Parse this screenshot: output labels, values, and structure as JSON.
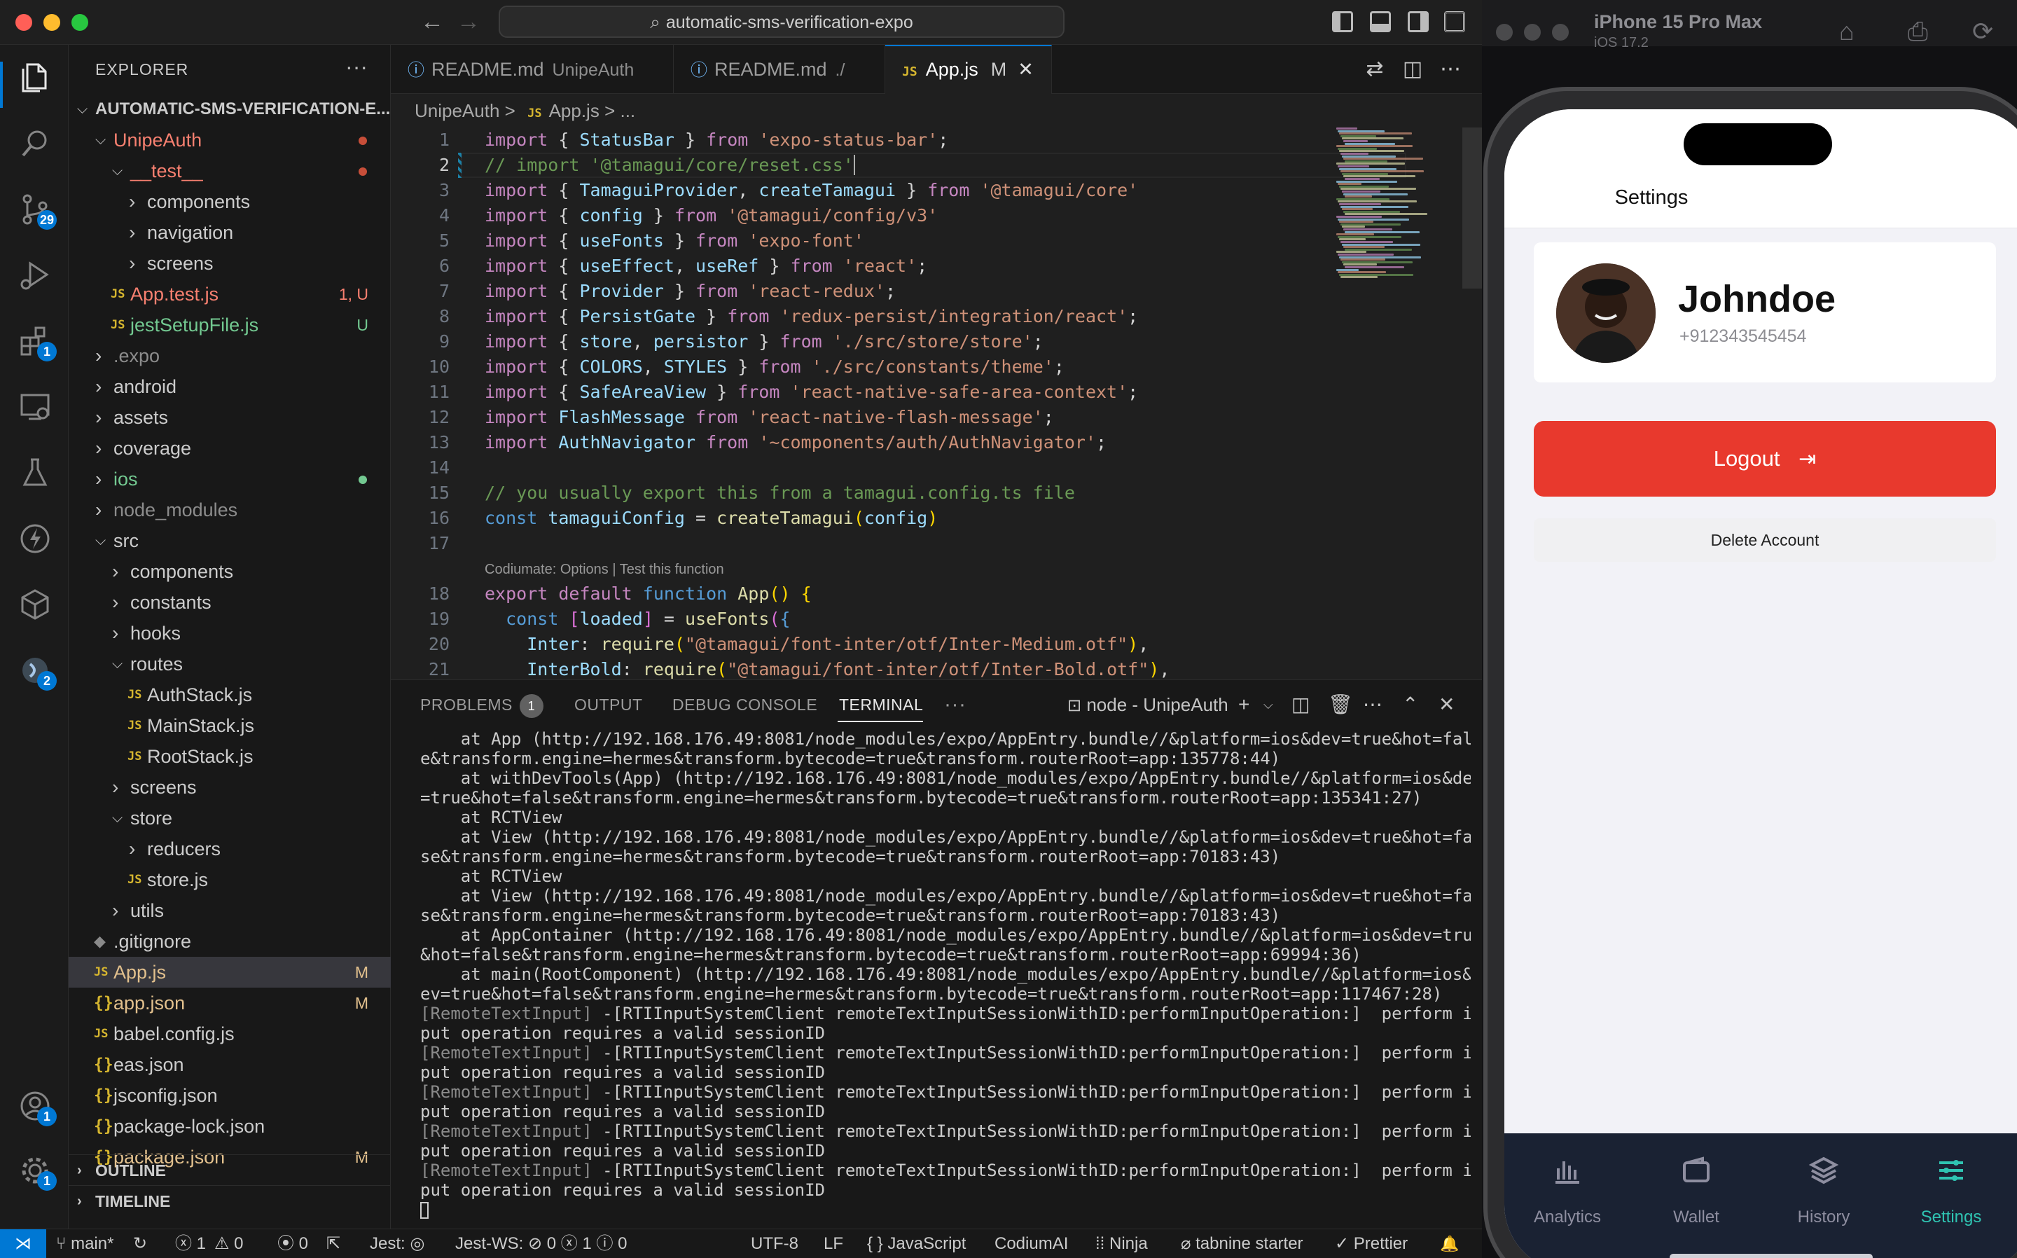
{
  "window": {
    "search_text": "automatic-sms-verification-expo",
    "back_arrow": "←",
    "forward_arrow": "→"
  },
  "activity_bar": {
    "source_control_badge": "29",
    "extensions_badge": "1",
    "codium_badge": "2",
    "accounts_badge": "1",
    "settings_badge": "1"
  },
  "explorer": {
    "title": "EXPLORER",
    "more": "···",
    "project": "AUTOMATIC-SMS-VERIFICATION-E...",
    "tree": [
      {
        "label": "UnipeAuth",
        "type": "folder",
        "open": true,
        "depth": 0,
        "color": "#f88070",
        "dot": "#c74e39"
      },
      {
        "label": "__test__",
        "type": "folder",
        "open": true,
        "depth": 1,
        "color": "#f88070",
        "dot": "#c74e39"
      },
      {
        "label": "components",
        "type": "folder",
        "open": false,
        "depth": 2
      },
      {
        "label": "navigation",
        "type": "folder",
        "open": false,
        "depth": 2
      },
      {
        "label": "screens",
        "type": "folder",
        "open": false,
        "depth": 2
      },
      {
        "label": "App.test.js",
        "type": "js",
        "depth": 1,
        "color": "#f88070",
        "status": "1, U",
        "status_color": "#f88070"
      },
      {
        "label": "jestSetupFile.js",
        "type": "js",
        "depth": 1,
        "color": "#73c991",
        "status": "U",
        "status_color": "#73c991"
      },
      {
        "label": ".expo",
        "type": "folder",
        "open": false,
        "depth": 0,
        "color": "#8c8c8c"
      },
      {
        "label": "android",
        "type": "folder",
        "open": false,
        "depth": 0
      },
      {
        "label": "assets",
        "type": "folder",
        "open": false,
        "depth": 0
      },
      {
        "label": "coverage",
        "type": "folder",
        "open": false,
        "depth": 0
      },
      {
        "label": "ios",
        "type": "folder",
        "open": false,
        "depth": 0,
        "color": "#73c991",
        "dot": "#73c991"
      },
      {
        "label": "node_modules",
        "type": "folder",
        "open": false,
        "depth": 0,
        "color": "#8c8c8c"
      },
      {
        "label": "src",
        "type": "folder",
        "open": true,
        "depth": 0
      },
      {
        "label": "components",
        "type": "folder",
        "open": false,
        "depth": 1
      },
      {
        "label": "constants",
        "type": "folder",
        "open": false,
        "depth": 1
      },
      {
        "label": "hooks",
        "type": "folder",
        "open": false,
        "depth": 1
      },
      {
        "label": "routes",
        "type": "folder",
        "open": true,
        "depth": 1
      },
      {
        "label": "AuthStack.js",
        "type": "js",
        "depth": 2
      },
      {
        "label": "MainStack.js",
        "type": "js",
        "depth": 2
      },
      {
        "label": "RootStack.js",
        "type": "js",
        "depth": 2
      },
      {
        "label": "screens",
        "type": "folder",
        "open": false,
        "depth": 1
      },
      {
        "label": "store",
        "type": "folder",
        "open": true,
        "depth": 1
      },
      {
        "label": "reducers",
        "type": "folder",
        "open": false,
        "depth": 2
      },
      {
        "label": "store.js",
        "type": "js",
        "depth": 2
      },
      {
        "label": "utils",
        "type": "folder",
        "open": false,
        "depth": 1
      },
      {
        "label": ".gitignore",
        "type": "git",
        "depth": 0
      },
      {
        "label": "App.js",
        "type": "js",
        "depth": 0,
        "color": "#e2c08d",
        "status": "M",
        "status_color": "#e2c08d",
        "selected": true
      },
      {
        "label": "app.json",
        "type": "json",
        "depth": 0,
        "color": "#e2c08d",
        "status": "M",
        "status_color": "#e2c08d"
      },
      {
        "label": "babel.config.js",
        "type": "js",
        "depth": 0
      },
      {
        "label": "eas.json",
        "type": "json",
        "depth": 0
      },
      {
        "label": "jsconfig.json",
        "type": "json",
        "depth": 0
      },
      {
        "label": "package-lock.json",
        "type": "json",
        "depth": 0
      },
      {
        "label": "package.json",
        "type": "json",
        "depth": 0,
        "color": "#e2c08d",
        "status": "M",
        "status_color": "#e2c08d"
      }
    ],
    "outline": "OUTLINE",
    "timeline": "TIMELINE"
  },
  "tabs": [
    {
      "icon": "ⓘ",
      "label": "README.md",
      "detail": "UnipeAuth",
      "active": false
    },
    {
      "icon": "ⓘ",
      "label": "README.md",
      "detail": "./",
      "active": false
    },
    {
      "icon": "JS",
      "label": "App.js",
      "detail": "M",
      "active": true,
      "close": "✕"
    }
  ],
  "breadcrumb": {
    "folder": "UnipeAuth",
    "sep": ">",
    "file": "App.js",
    "trail": "> ..."
  },
  "editor": {
    "codelens": "Codiumate: Options | Test this function",
    "lines": [
      {
        "n": "1",
        "tokens": [
          [
            "kw",
            "import"
          ],
          [
            "pn",
            " { "
          ],
          [
            "id",
            "StatusBar"
          ],
          [
            "pn",
            " } "
          ],
          [
            "kw",
            "from"
          ],
          [
            "str",
            " 'expo-status-bar'"
          ],
          [
            "pn",
            ";"
          ]
        ]
      },
      {
        "n": "2",
        "tokens": [
          [
            "cm",
            "// import '@tamagui/core/reset.css'"
          ]
        ]
      },
      {
        "n": "3",
        "tokens": [
          [
            "kw",
            "import"
          ],
          [
            "pn",
            " { "
          ],
          [
            "id",
            "TamaguiProvider"
          ],
          [
            "pn",
            ", "
          ],
          [
            "id",
            "createTamagui"
          ],
          [
            "pn",
            " } "
          ],
          [
            "kw",
            "from"
          ],
          [
            "str",
            " '@tamagui/core'"
          ]
        ]
      },
      {
        "n": "4",
        "tokens": [
          [
            "kw",
            "import"
          ],
          [
            "pn",
            " { "
          ],
          [
            "id",
            "config"
          ],
          [
            "pn",
            " } "
          ],
          [
            "kw",
            "from"
          ],
          [
            "str",
            " '@tamagui/config/v3'"
          ]
        ]
      },
      {
        "n": "5",
        "tokens": [
          [
            "kw",
            "import"
          ],
          [
            "pn",
            " { "
          ],
          [
            "id",
            "useFonts"
          ],
          [
            "pn",
            " } "
          ],
          [
            "kw",
            "from"
          ],
          [
            "str",
            " 'expo-font'"
          ]
        ]
      },
      {
        "n": "6",
        "tokens": [
          [
            "kw",
            "import"
          ],
          [
            "pn",
            " { "
          ],
          [
            "id",
            "useEffect"
          ],
          [
            "pn",
            ", "
          ],
          [
            "id",
            "useRef"
          ],
          [
            "pn",
            " } "
          ],
          [
            "kw",
            "from"
          ],
          [
            "str",
            " 'react'"
          ],
          [
            "pn",
            ";"
          ]
        ]
      },
      {
        "n": "7",
        "tokens": [
          [
            "kw",
            "import"
          ],
          [
            "pn",
            " { "
          ],
          [
            "id",
            "Provider"
          ],
          [
            "pn",
            " } "
          ],
          [
            "kw",
            "from"
          ],
          [
            "str",
            " 'react-redux'"
          ],
          [
            "pn",
            ";"
          ]
        ]
      },
      {
        "n": "8",
        "tokens": [
          [
            "kw",
            "import"
          ],
          [
            "pn",
            " { "
          ],
          [
            "id",
            "PersistGate"
          ],
          [
            "pn",
            " } "
          ],
          [
            "kw",
            "from"
          ],
          [
            "str",
            " 'redux-persist/integration/react'"
          ],
          [
            "pn",
            ";"
          ]
        ]
      },
      {
        "n": "9",
        "tokens": [
          [
            "kw",
            "import"
          ],
          [
            "pn",
            " { "
          ],
          [
            "id",
            "store"
          ],
          [
            "pn",
            ", "
          ],
          [
            "id",
            "persistor"
          ],
          [
            "pn",
            " } "
          ],
          [
            "kw",
            "from"
          ],
          [
            "str",
            " './src/store/store'"
          ],
          [
            "pn",
            ";"
          ]
        ]
      },
      {
        "n": "10",
        "tokens": [
          [
            "kw",
            "import"
          ],
          [
            "pn",
            " { "
          ],
          [
            "id",
            "COLORS"
          ],
          [
            "pn",
            ", "
          ],
          [
            "id",
            "STYLES"
          ],
          [
            "pn",
            " } "
          ],
          [
            "kw",
            "from"
          ],
          [
            "str",
            " './src/constants/theme'"
          ],
          [
            "pn",
            ";"
          ]
        ]
      },
      {
        "n": "11",
        "tokens": [
          [
            "kw",
            "import"
          ],
          [
            "pn",
            " { "
          ],
          [
            "id",
            "SafeAreaView"
          ],
          [
            "pn",
            " } "
          ],
          [
            "kw",
            "from"
          ],
          [
            "str",
            " 'react-native-safe-area-context'"
          ],
          [
            "pn",
            ";"
          ]
        ]
      },
      {
        "n": "12",
        "tokens": [
          [
            "kw",
            "import"
          ],
          [
            "id",
            " FlashMessage"
          ],
          [
            "kw",
            " from"
          ],
          [
            "str",
            " 'react-native-flash-message'"
          ],
          [
            "pn",
            ";"
          ]
        ]
      },
      {
        "n": "13",
        "tokens": [
          [
            "kw",
            "import"
          ],
          [
            "id",
            " AuthNavigator"
          ],
          [
            "kw",
            " from"
          ],
          [
            "str",
            " '~components/auth/AuthNavigator'"
          ],
          [
            "pn",
            ";"
          ]
        ]
      },
      {
        "n": "14",
        "tokens": []
      },
      {
        "n": "15",
        "tokens": [
          [
            "cm",
            "// you usually export this from a tamagui.config.ts file"
          ]
        ]
      },
      {
        "n": "16",
        "tokens": [
          [
            "kw2",
            "const"
          ],
          [
            "id",
            " tamaguiConfig"
          ],
          [
            "pn",
            " = "
          ],
          [
            "fn",
            "createTamagui"
          ],
          [
            "br",
            "("
          ],
          [
            "id",
            "config"
          ],
          [
            "br",
            ")"
          ]
        ]
      },
      {
        "n": "17",
        "tokens": []
      },
      {
        "n": "18",
        "tokens": [
          [
            "kw",
            "export"
          ],
          [
            "kw",
            " default"
          ],
          [
            "kw2",
            " function"
          ],
          [
            "fn",
            " App"
          ],
          [
            "br",
            "()"
          ],
          [
            "pn",
            " "
          ],
          [
            "br",
            "{"
          ]
        ]
      },
      {
        "n": "19",
        "tokens": [
          [
            "pn",
            "  "
          ],
          [
            "kw2",
            "const"
          ],
          [
            "pn",
            " "
          ],
          [
            "br2",
            "["
          ],
          [
            "id",
            "loaded"
          ],
          [
            "br2",
            "]"
          ],
          [
            "pn",
            " = "
          ],
          [
            "fn",
            "useFonts"
          ],
          [
            "br2",
            "("
          ],
          [
            "kw2",
            "{"
          ]
        ]
      },
      {
        "n": "20",
        "tokens": [
          [
            "pn",
            "    "
          ],
          [
            "id",
            "Inter"
          ],
          [
            "pn",
            ": "
          ],
          [
            "fn",
            "require"
          ],
          [
            "br",
            "("
          ],
          [
            "str",
            "\"@tamagui/font-inter/otf/Inter-Medium.otf\""
          ],
          [
            "br",
            ")"
          ],
          [
            "pn",
            ","
          ]
        ]
      },
      {
        "n": "21",
        "tokens": [
          [
            "pn",
            "    "
          ],
          [
            "id",
            "InterBold"
          ],
          [
            "pn",
            ": "
          ],
          [
            "fn",
            "require"
          ],
          [
            "br",
            "("
          ],
          [
            "str",
            "\"@tamagui/font-inter/otf/Inter-Bold.otf\""
          ],
          [
            "br",
            ")"
          ],
          [
            "pn",
            ","
          ]
        ]
      }
    ]
  },
  "panel": {
    "tabs": {
      "problems": "PROBLEMS",
      "problems_count": "1",
      "output": "OUTPUT",
      "debug": "DEBUG CONSOLE",
      "terminal": "TERMINAL",
      "more": "···"
    },
    "terminal_name": "node - UnipeAuth",
    "lines": [
      [
        "",
        "    at App (http://192.168.176.49:8081/node_modules/expo/AppEntry.bundle//&platform=ios&dev=true&hot=fals"
      ],
      [
        "",
        "e&transform.engine=hermes&transform.bytecode=true&transform.routerRoot=app:135778:44)"
      ],
      [
        "",
        "    at withDevTools(App) (http://192.168.176.49:8081/node_modules/expo/AppEntry.bundle//&platform=ios&dev"
      ],
      [
        "",
        "=true&hot=false&transform.engine=hermes&transform.bytecode=true&transform.routerRoot=app:135341:27)"
      ],
      [
        "",
        "    at RCTView"
      ],
      [
        "",
        "    at View (http://192.168.176.49:8081/node_modules/expo/AppEntry.bundle//&platform=ios&dev=true&hot=fal"
      ],
      [
        "",
        "se&transform.engine=hermes&transform.bytecode=true&transform.routerRoot=app:70183:43)"
      ],
      [
        "",
        "    at RCTView"
      ],
      [
        "",
        "    at View (http://192.168.176.49:8081/node_modules/expo/AppEntry.bundle//&platform=ios&dev=true&hot=fal"
      ],
      [
        "",
        "se&transform.engine=hermes&transform.bytecode=true&transform.routerRoot=app:70183:43)"
      ],
      [
        "",
        "    at AppContainer (http://192.168.176.49:8081/node_modules/expo/AppEntry.bundle//&platform=ios&dev=true"
      ],
      [
        "",
        "&hot=false&transform.engine=hermes&transform.bytecode=true&transform.routerRoot=app:69994:36)"
      ],
      [
        "",
        "    at main(RootComponent) (http://192.168.176.49:8081/node_modules/expo/AppEntry.bundle//&platform=ios&d"
      ],
      [
        "",
        "ev=true&hot=false&transform.engine=hermes&transform.bytecode=true&transform.routerRoot=app:117467:28)"
      ],
      [
        "[RemoteTextInput]",
        " -[RTIInputSystemClient remoteTextInputSessionWithID:performInputOperation:]  perform in"
      ],
      [
        "",
        "put operation requires a valid sessionID"
      ],
      [
        "[RemoteTextInput]",
        " -[RTIInputSystemClient remoteTextInputSessionWithID:performInputOperation:]  perform in"
      ],
      [
        "",
        "put operation requires a valid sessionID"
      ],
      [
        "[RemoteTextInput]",
        " -[RTIInputSystemClient remoteTextInputSessionWithID:performInputOperation:]  perform in"
      ],
      [
        "",
        "put operation requires a valid sessionID"
      ],
      [
        "[RemoteTextInput]",
        " -[RTIInputSystemClient remoteTextInputSessionWithID:performInputOperation:]  perform in"
      ],
      [
        "",
        "put operation requires a valid sessionID"
      ],
      [
        "[RemoteTextInput]",
        " -[RTIInputSystemClient remoteTextInputSessionWithID:performInputOperation:]  perform in"
      ],
      [
        "",
        "put operation requires a valid sessionID"
      ]
    ]
  },
  "statusbar": {
    "branch": "main*",
    "sync": "↻",
    "errors": "ⓧ 1",
    "warnings": "⚠ 0",
    "ports": "⦿ 0",
    "jest": "Jest: ◎",
    "jest_ws": "Jest-WS: ⊘ 0 ⓧ 1 ⓘ 0",
    "encoding": "UTF-8",
    "eol": "LF",
    "language": "{ } JavaScript",
    "codium": "CodiumAI",
    "ninja": "⁞⁞ Ninja",
    "tabnine": "⌀ tabnine starter",
    "prettier": "✓ Prettier",
    "bell": "🔔"
  },
  "simulator": {
    "device": "iPhone 15 Pro Max",
    "os": "iOS 17.2",
    "app": {
      "title": "Settings",
      "name": "Johndoe",
      "phone": "+912343545454",
      "logout": "Logout",
      "delete": "Delete Account",
      "tabs": [
        {
          "label": "Analytics",
          "icon": "bar-chart-icon",
          "active": false
        },
        {
          "label": "Wallet",
          "icon": "wallet-icon",
          "active": false
        },
        {
          "label": "History",
          "icon": "layers-icon",
          "active": false
        },
        {
          "label": "Settings",
          "icon": "sliders-icon",
          "active": true
        }
      ],
      "accent": "#2fc4b2",
      "logout_color": "#e8392d"
    }
  }
}
